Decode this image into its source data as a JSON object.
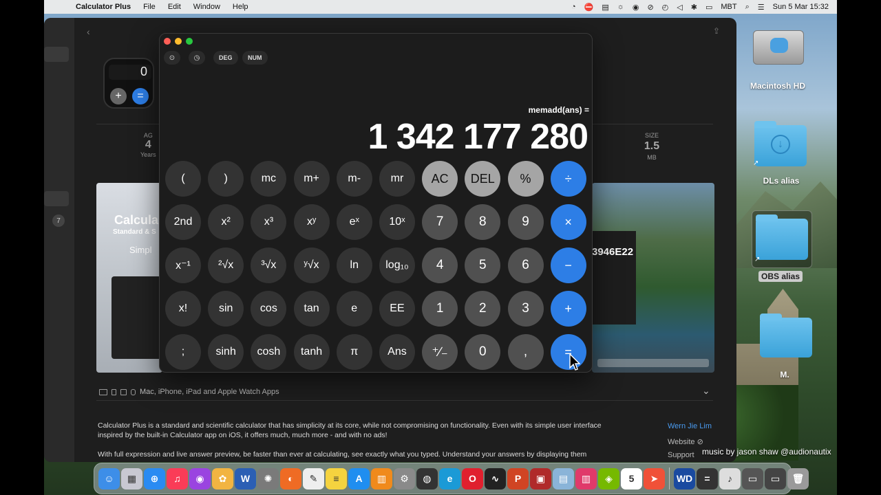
{
  "menubar": {
    "app_name": "Calculator Plus",
    "menus": [
      "File",
      "Edit",
      "Window",
      "Help"
    ],
    "status_glyphs": [
      "◔",
      "⛔",
      "▤",
      "☼",
      "◉",
      "⊘",
      "◴",
      "◁",
      "✱",
      "▭"
    ],
    "input_source": "MBT",
    "datetime": "Sun 5 Mar  15:32"
  },
  "store": {
    "stat_left": {
      "label": "AG",
      "value": "4",
      "unit": "Years"
    },
    "size": {
      "label": "SIZE",
      "value": "1.5",
      "unit": "MB"
    },
    "sidebar_badge": "7",
    "icon_display": "0",
    "screenshot_left": {
      "title": "Calcula",
      "subtitle": "Standard & S",
      "tag": "Simpl"
    },
    "screenshot_right_display": "3946E22",
    "platforms": "Mac, iPhone, iPad and Apple Watch Apps",
    "description": [
      "Calculator Plus is a standard and scientific calculator that has simplicity at its core, while not compromising on functionality. Even with its simple user interface inspired by the built-in Calculator app on iOS, it offers much, much more - and with no ads!",
      "With full expression and live answer preview, be faster than ever at calculating, see exactly what you typed. Understand your answers by displaying them"
    ],
    "developer": "Wern Jie Lim",
    "website": "Website",
    "support": "Support"
  },
  "calculator": {
    "toolbar": {
      "deg": "DEG",
      "num": "NUM"
    },
    "expression": "memadd(ans) =",
    "result": "1 342 177 280",
    "keys": [
      [
        "(",
        ")",
        "mc",
        "m+",
        "m-",
        "mr",
        "AC",
        "DEL",
        "%",
        "÷"
      ],
      [
        "2nd",
        "x²",
        "x³",
        "xʸ",
        "eˣ",
        "10ˣ",
        "7",
        "8",
        "9",
        "×"
      ],
      [
        "x⁻¹",
        "²√x",
        "³√x",
        "ʸ√x",
        "ln",
        "log₁₀",
        "4",
        "5",
        "6",
        "−"
      ],
      [
        "x!",
        "sin",
        "cos",
        "tan",
        "e",
        "EE",
        "1",
        "2",
        "3",
        "+"
      ],
      [
        ";",
        "sinh",
        "cosh",
        "tanh",
        "π",
        "Ans",
        "⁺∕₋",
        "0",
        ",",
        "="
      ]
    ]
  },
  "desktop": {
    "macintosh_hd": "Macintosh HD",
    "dls_alias": "DLs alias",
    "obs_alias": "OBS alias",
    "folder_m": "M."
  },
  "watermark": "music by jason shaw @audionautix",
  "dock": {
    "items": [
      {
        "name": "finder",
        "color": "#3d8ee8",
        "glyph": "☺"
      },
      {
        "name": "launchpad",
        "color": "#c8c8d2",
        "glyph": "▦"
      },
      {
        "name": "safari",
        "color": "#2a8bf2",
        "glyph": "⊕"
      },
      {
        "name": "music",
        "color": "#fa3c57",
        "glyph": "♫"
      },
      {
        "name": "podcasts",
        "color": "#9a44e0",
        "glyph": "◉"
      },
      {
        "name": "photos",
        "color": "#f2b441",
        "glyph": "✿"
      },
      {
        "name": "word",
        "color": "#2b5fb4",
        "glyph": "W"
      },
      {
        "name": "settings-wheel",
        "color": "#7a7a7a",
        "glyph": "✺"
      },
      {
        "name": "firefox",
        "color": "#ef6b24",
        "glyph": "◐"
      },
      {
        "name": "textedit",
        "color": "#eeeeee",
        "glyph": "✎"
      },
      {
        "name": "notes",
        "color": "#f5d33f",
        "glyph": "≡"
      },
      {
        "name": "app-store",
        "color": "#1f8ef0",
        "glyph": "A"
      },
      {
        "name": "books",
        "color": "#f08a1c",
        "glyph": "▥"
      },
      {
        "name": "system-preferences",
        "color": "#8a8a8a",
        "glyph": "⚙"
      },
      {
        "name": "obs",
        "color": "#333333",
        "glyph": "◍"
      },
      {
        "name": "edge",
        "color": "#1b9ad6",
        "glyph": "e"
      },
      {
        "name": "opera",
        "color": "#e0202e",
        "glyph": "O"
      },
      {
        "name": "activity-monitor",
        "color": "#222222",
        "glyph": "∿"
      },
      {
        "name": "powerpoint",
        "color": "#d04423",
        "glyph": "P"
      },
      {
        "name": "app-red",
        "color": "#b02a2a",
        "glyph": "▣"
      },
      {
        "name": "app-grid",
        "color": "#8ab4d8",
        "glyph": "▤"
      },
      {
        "name": "app-stripes",
        "color": "#e03a6a",
        "glyph": "▥"
      },
      {
        "name": "nvidia",
        "color": "#76b900",
        "glyph": "◈"
      },
      {
        "name": "calendar",
        "color": "#ffffff",
        "glyph": "5"
      },
      {
        "name": "swift",
        "color": "#f05138",
        "glyph": "➤"
      },
      {
        "name": "wd",
        "color": "#1a4aa0",
        "glyph": "WD"
      },
      {
        "name": "calculator",
        "color": "#333333",
        "glyph": "="
      },
      {
        "name": "music-file",
        "color": "#dddddd",
        "glyph": "♪"
      },
      {
        "name": "display",
        "color": "#555555",
        "glyph": "▭"
      },
      {
        "name": "display-2",
        "color": "#444444",
        "glyph": "▭"
      },
      {
        "name": "trash",
        "color": "#9a9a9a",
        "glyph": "🗑"
      }
    ]
  }
}
